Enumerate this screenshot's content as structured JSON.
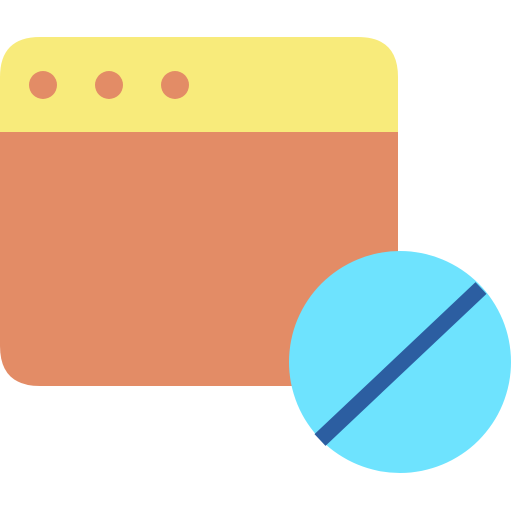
{
  "icon": {
    "name": "blocked-browser-window-icon",
    "colors": {
      "window_titlebar": "#F8EB7B",
      "window_body": "#E38C66",
      "window_dot": "#E38C66",
      "block_circle": "#6EE3FE",
      "block_slash": "#2C5EA1",
      "background": "#FFFFFF"
    }
  }
}
